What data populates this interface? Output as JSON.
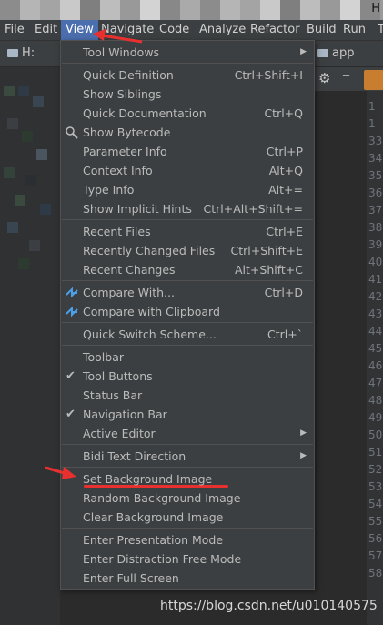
{
  "window_title_fragment": "H",
  "menubar": {
    "items": [
      "File",
      "Edit",
      "View",
      "Navigate",
      "Code",
      "Analyze",
      "Refactor",
      "Build",
      "Run",
      "T"
    ],
    "active": "View"
  },
  "navbar": {
    "left_crumb": "H:",
    "right_crumb": "app"
  },
  "view_menu": {
    "sections": [
      [
        {
          "label": "Tool Windows",
          "submenu": true
        }
      ],
      [
        {
          "label": "Quick Definition",
          "shortcut": "Ctrl+Shift+I"
        },
        {
          "label": "Show Siblings",
          "shortcut": ""
        },
        {
          "label": "Quick Documentation",
          "shortcut": "Ctrl+Q"
        },
        {
          "label": "Show Bytecode",
          "shortcut": "",
          "icon": "bytecode-icon"
        },
        {
          "label": "Parameter Info",
          "shortcut": "Ctrl+P"
        },
        {
          "label": "Context Info",
          "shortcut": "Alt+Q"
        },
        {
          "label": "Type Info",
          "shortcut": "Alt+="
        },
        {
          "label": "Show Implicit Hints",
          "shortcut": "Ctrl+Alt+Shift+="
        }
      ],
      [
        {
          "label": "Recent Files",
          "shortcut": "Ctrl+E"
        },
        {
          "label": "Recently Changed Files",
          "shortcut": "Ctrl+Shift+E"
        },
        {
          "label": "Recent Changes",
          "shortcut": "Alt+Shift+C"
        }
      ],
      [
        {
          "label": "Compare With...",
          "shortcut": "Ctrl+D",
          "icon": "compare-icon"
        },
        {
          "label": "Compare with Clipboard",
          "shortcut": "",
          "icon": "compare-clipboard-icon"
        }
      ],
      [
        {
          "label": "Quick Switch Scheme...",
          "shortcut": "Ctrl+`"
        }
      ],
      [
        {
          "label": "Toolbar",
          "shortcut": ""
        },
        {
          "label": "Tool Buttons",
          "shortcut": "",
          "checked": true
        },
        {
          "label": "Status Bar",
          "shortcut": ""
        },
        {
          "label": "Navigation Bar",
          "shortcut": "",
          "checked": true
        },
        {
          "label": "Active Editor",
          "submenu": true
        }
      ],
      [
        {
          "label": "Bidi Text Direction",
          "submenu": true
        }
      ],
      [
        {
          "label": "Set Background Image",
          "shortcut": "",
          "highlighted": true
        },
        {
          "label": "Random Background Image",
          "shortcut": ""
        },
        {
          "label": "Clear Background Image",
          "shortcut": ""
        }
      ],
      [
        {
          "label": "Enter Presentation Mode",
          "shortcut": ""
        },
        {
          "label": "Enter Distraction Free Mode",
          "shortcut": ""
        },
        {
          "label": "Enter Full Screen",
          "shortcut": ""
        }
      ]
    ]
  },
  "gutter_numbers": [
    "1",
    "1",
    "33",
    "34",
    "35",
    "36",
    "37",
    "38",
    "39",
    "40",
    "41",
    "42",
    "43",
    "44",
    "45",
    "46",
    "47",
    "48",
    "49",
    "50",
    "51",
    "52",
    "53",
    "54",
    "55",
    "56",
    "57",
    "58"
  ],
  "watermark": "https://blog.csdn.net/u010140575",
  "colors": {
    "menubar_active": "#4b6eaf",
    "annotation_red": "#e8312f",
    "menu_bg": "#3c3f41",
    "accent_orange": "#c87e2e"
  }
}
